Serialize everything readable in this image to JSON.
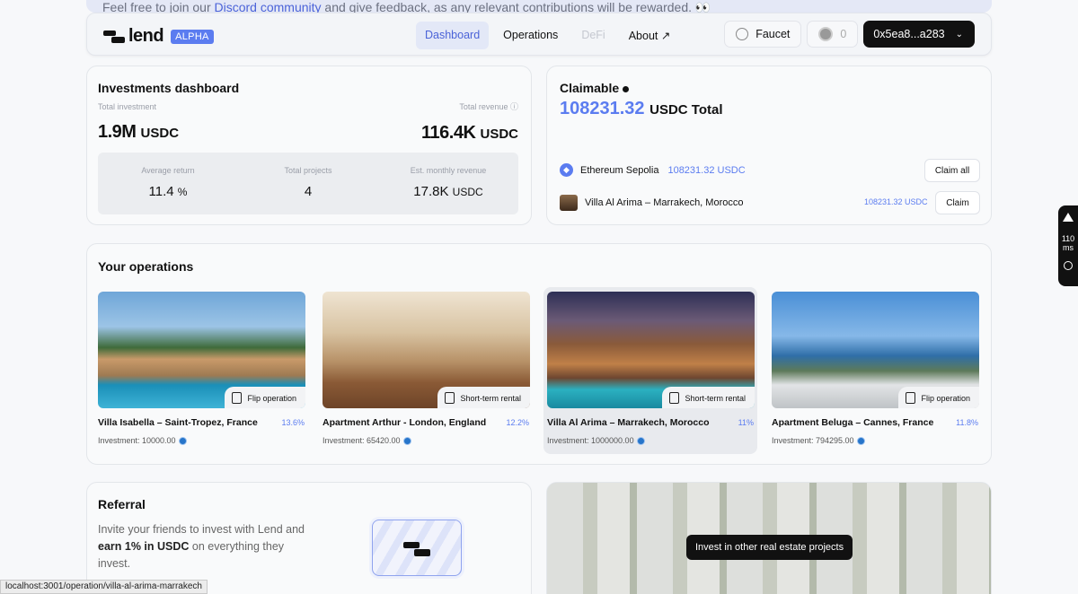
{
  "banner": {
    "prefix": "Feel free to join our ",
    "link": "Discord community",
    "suffix": " and give feedback, as any relevant contributions will be rewarded. 👀"
  },
  "header": {
    "logo": "lend",
    "badge": "ALPHA",
    "nav": [
      "Dashboard",
      "Operations",
      "DeFi",
      "About ↗"
    ],
    "faucet": "Faucet",
    "points": "0",
    "wallet": "0x5ea8...a283"
  },
  "dashboard": {
    "title": "Investments dashboard",
    "total_investment_label": "Total investment",
    "total_investment": "1.9M",
    "total_investment_unit": "USDC",
    "total_revenue_label": "Total revenue",
    "total_revenue": "116.4K",
    "total_revenue_unit": "USDC",
    "stats": [
      {
        "label": "Average return",
        "value": "11.4",
        "unit": "%"
      },
      {
        "label": "Total projects",
        "value": "4",
        "unit": ""
      },
      {
        "label": "Est. monthly revenue",
        "value": "17.8K",
        "unit": "USDC"
      }
    ]
  },
  "claimable": {
    "title": "Claimable",
    "total": "108231.32",
    "total_unit": "USDC Total",
    "rows": [
      {
        "name": "Ethereum Sepolia",
        "amount": "108231.32 USDC",
        "action": "Claim all"
      },
      {
        "name": "Villa Al Arima – Marrakech, Morocco",
        "amount": "108231.32 USDC",
        "action": "Claim"
      }
    ]
  },
  "operations": {
    "title": "Your operations",
    "items": [
      {
        "title": "Villa Isabella – Saint-Tropez, France",
        "yield": "13.6%",
        "type": "Flip operation",
        "investment": "Investment: 10000.00"
      },
      {
        "title": "Apartment Arthur - London, England",
        "yield": "12.2%",
        "type": "Short-term rental",
        "investment": "Investment: 65420.00"
      },
      {
        "title": "Villa Al Arima – Marrakech, Morocco",
        "yield": "11%",
        "type": "Short-term rental",
        "investment": "Investment: 1000000.00"
      },
      {
        "title": "Apartment Beluga – Cannes, France",
        "yield": "11.8%",
        "type": "Flip operation",
        "investment": "Investment: 794295.00"
      }
    ]
  },
  "referral": {
    "title": "Referral",
    "text_1": "Invite your friends to invest with Lend and ",
    "text_bold": "earn 1% in USDC",
    "text_2": " on everything they invest."
  },
  "invest_more": {
    "label": "Invest in other real estate projects"
  },
  "status_url": "localhost:3001/operation/villa-al-arima-marrakech",
  "devtools": {
    "value": "110",
    "unit": "ms"
  }
}
